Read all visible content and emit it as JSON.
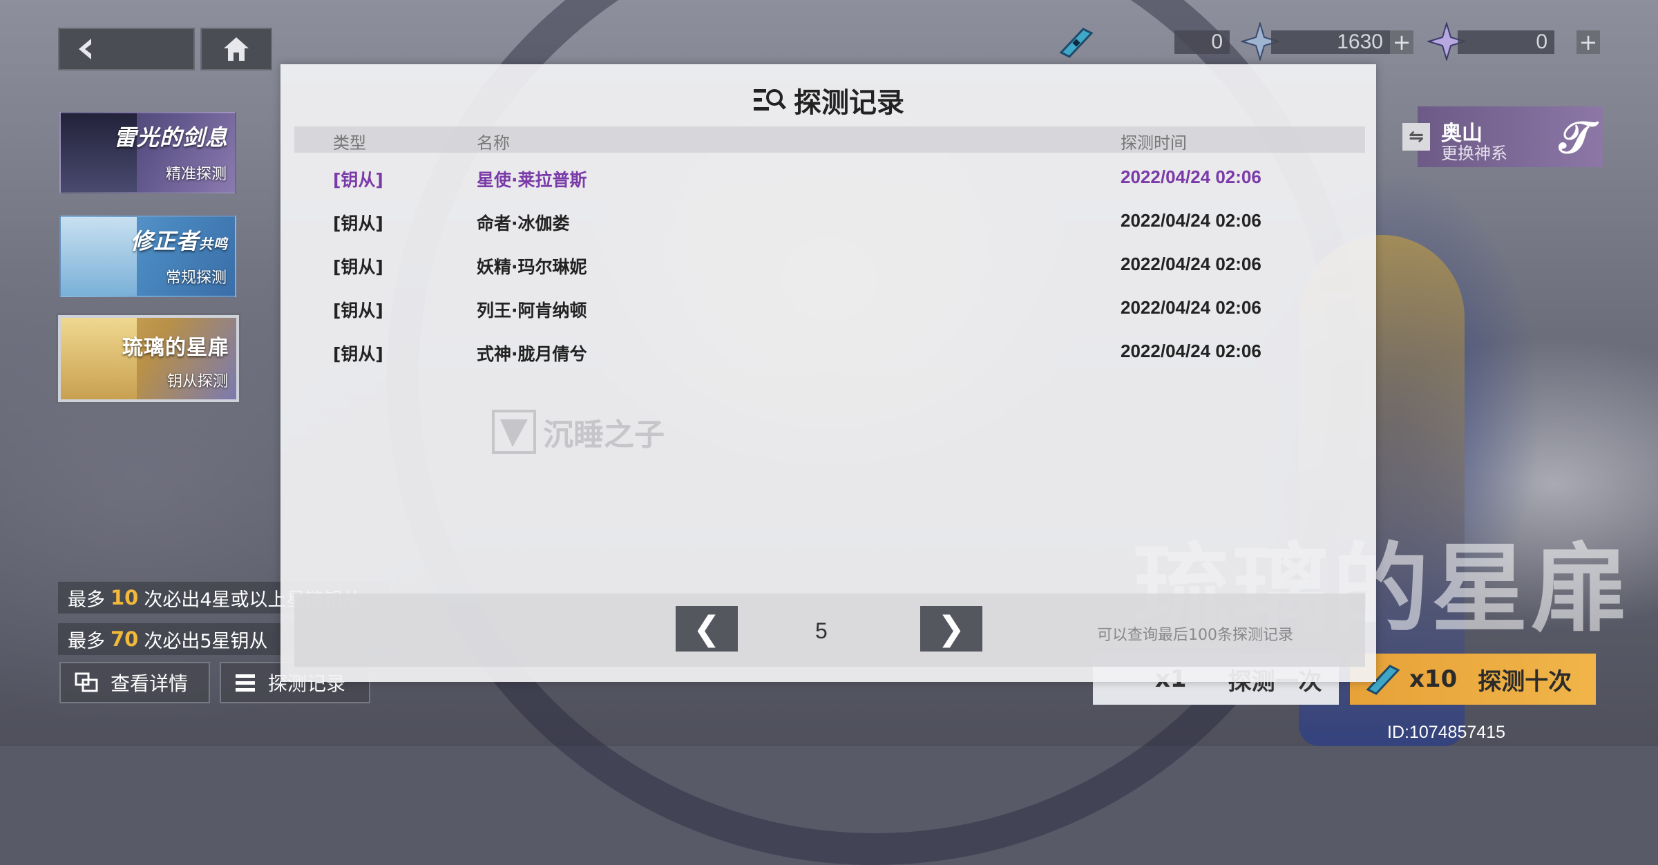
{
  "top_bar": {
    "resources": [
      {
        "icon": "ticket-icon",
        "value": "0",
        "has_plus": false
      },
      {
        "icon": "silver-star-crystal-icon",
        "value": "1630",
        "has_plus": true
      },
      {
        "icon": "purple-star-crystal-icon",
        "value": "0",
        "has_plus": true
      }
    ],
    "plus_label": "+"
  },
  "banners": [
    {
      "title": "雷光的剑息",
      "subtitle": "精准探测",
      "selected": false,
      "accent": "#5a4a8a"
    },
    {
      "title": "修正者",
      "title_suffix": "共鸣",
      "subtitle": "常规探测",
      "selected": false,
      "accent": "#4a90c8"
    },
    {
      "title": "琉璃的星扉",
      "subtitle": "钥从探测",
      "selected": true,
      "accent": "#c89a3a"
    }
  ],
  "rules": [
    {
      "prefix": "最多",
      "count": "10",
      "suffix": "次必出4星或以上星链钥从"
    },
    {
      "prefix": "最多",
      "count": "70",
      "suffix": "次必出5星钥从"
    }
  ],
  "bottom_left": {
    "details_label": "查看详情",
    "records_label": "探测记录"
  },
  "switch_panel": {
    "name": "奥山",
    "sub": "更换神系",
    "swap_icon": "⇋"
  },
  "background_title": "琉璃的星扉",
  "pull_buttons": {
    "single": {
      "count": "x1",
      "label": "探测一次"
    },
    "ten": {
      "count": "x10",
      "label": "探测十次"
    }
  },
  "uid": "ID:1074857415",
  "modal": {
    "title": "探测记录",
    "headers": {
      "type": "类型",
      "name": "名称",
      "time": "探测时间"
    },
    "rows": [
      {
        "type": "[钥从]",
        "name": "星使·莱拉普斯",
        "time": "2022/04/24 02:06",
        "highlight": true
      },
      {
        "type": "[钥从]",
        "name": "命者·冰伽娄",
        "time": "2022/04/24 02:06",
        "highlight": false
      },
      {
        "type": "[钥从]",
        "name": "妖精·玛尔琳妮",
        "time": "2022/04/24 02:06",
        "highlight": false
      },
      {
        "type": "[钥从]",
        "name": "列王·阿肯纳顿",
        "time": "2022/04/24 02:06",
        "highlight": false
      },
      {
        "type": "[钥从]",
        "name": "式神·胧月倩兮",
        "time": "2022/04/24 02:06",
        "highlight": false
      }
    ],
    "watermark": "沉睡之子",
    "pager": {
      "prev": "❮",
      "next": "❯",
      "page": "5",
      "note": "可以查询最后100条探测记录"
    },
    "highlight_color": "#7a3aa8"
  }
}
